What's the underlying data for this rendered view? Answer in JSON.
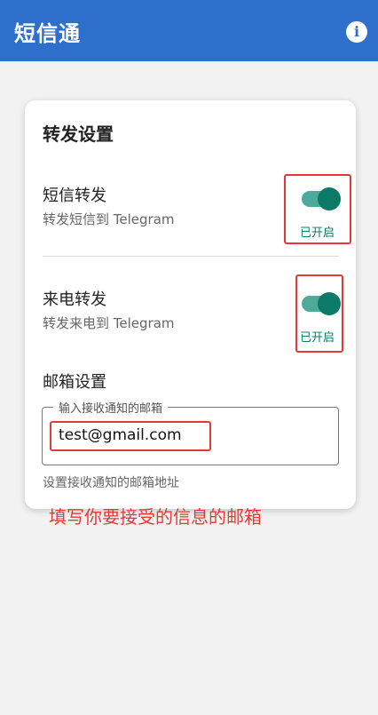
{
  "app": {
    "title": "短信通",
    "info_icon": "info-icon"
  },
  "card": {
    "title": "转发设置",
    "sms_forward": {
      "title": "短信转发",
      "subtitle": "转发短信到 Telegram",
      "enabled": true,
      "status": "已开启"
    },
    "call_forward": {
      "title": "来电转发",
      "subtitle": "转发来电到 Telegram",
      "enabled": true,
      "status": "已开启"
    },
    "email": {
      "section_title": "邮箱设置",
      "field_label": "输入接收通知的邮箱",
      "value": "test@gmail.com",
      "helper": "设置接收通知的邮箱地址"
    }
  },
  "annotation": "填写你要接受的信息的邮箱",
  "colors": {
    "appbar": "#2f6fcc",
    "switch_on": "#0c7a66",
    "annotation_red": "#e53935"
  }
}
